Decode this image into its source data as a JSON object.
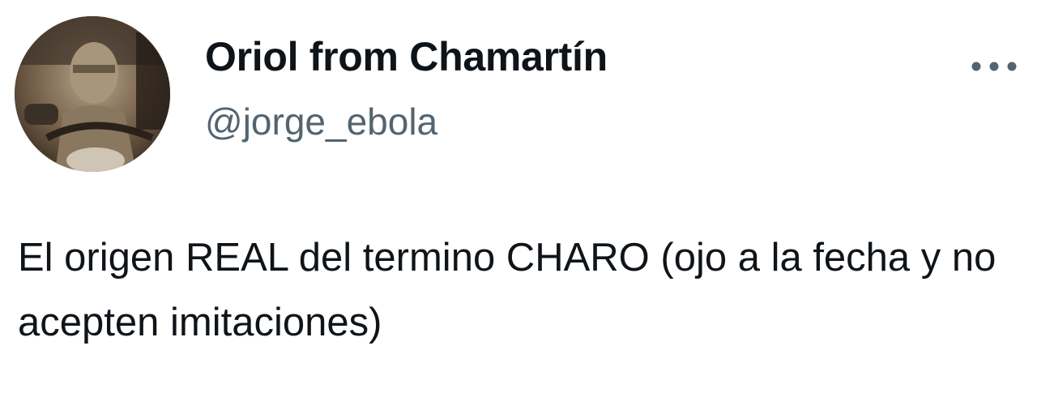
{
  "tweet": {
    "author": {
      "display_name": "Oriol from Chamartín",
      "handle": "@jorge_ebola",
      "avatar_icon": "avatar-photo"
    },
    "more_icon": "more-options-icon",
    "text": "El origen REAL del termino CHARO (ojo a la fecha y no acepten imitaciones)"
  },
  "colors": {
    "text_primary": "#0f1419",
    "text_secondary": "#536471",
    "background": "#ffffff"
  }
}
